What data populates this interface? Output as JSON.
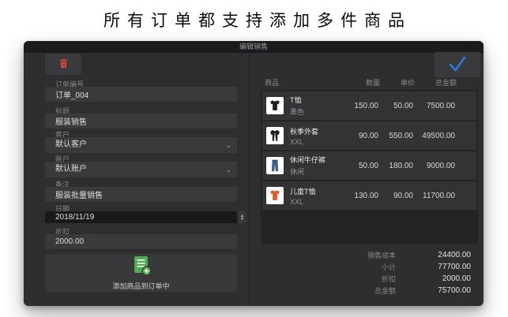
{
  "page": {
    "headline": "所有订单都支持添加多件商品"
  },
  "window": {
    "title": "编辑销售",
    "toolbar": {
      "delete_icon": "trash-icon",
      "confirm_icon": "check-icon"
    },
    "form": {
      "fields": [
        {
          "type": "text",
          "label": "订单编号",
          "value": "订单_004"
        },
        {
          "type": "text",
          "label": "标题",
          "value": "服装销售"
        },
        {
          "type": "select",
          "label": "客户",
          "value": "默认客户"
        },
        {
          "type": "select",
          "label": "账户",
          "value": "默认账户"
        },
        {
          "type": "text",
          "label": "备注",
          "value": "服装批量销售"
        },
        {
          "type": "date",
          "label": "日期",
          "value": "2018/11/19"
        },
        {
          "type": "text",
          "label": "折扣",
          "value": "2000.00"
        }
      ],
      "add_button_label": "添加商品到订单中",
      "add_button_icon": "invoice-add-icon"
    },
    "table": {
      "headers": [
        "商品",
        "数量",
        "单价",
        "总金额"
      ],
      "rows": [
        {
          "icon": "tshirt-black-icon",
          "name": "T恤",
          "variant": "黑色",
          "qty": "150.00",
          "price": "50.00",
          "total": "7500.00"
        },
        {
          "icon": "jacket-icon",
          "name": "秋季外套",
          "variant": "XXL",
          "qty": "90.00",
          "price": "550.00",
          "total": "49500.00"
        },
        {
          "icon": "jeans-icon",
          "name": "休闲牛仔裤",
          "variant": "休闲",
          "qty": "50.00",
          "price": "180.00",
          "total": "9000.00"
        },
        {
          "icon": "tshirt-orange-icon",
          "name": "儿童T恤",
          "variant": "XXL",
          "qty": "130.00",
          "price": "90.00",
          "total": "11700.00"
        }
      ]
    },
    "summary": [
      {
        "label": "销售成本",
        "value": "24400.00"
      },
      {
        "label": "小计",
        "value": "77700.00"
      },
      {
        "label": "折扣",
        "value": "2000.00"
      },
      {
        "label": "总金额",
        "value": "75700.00"
      }
    ]
  },
  "colors": {
    "accent_red": "#e14b3b",
    "accent_blue": "#2e7bdb",
    "accent_green": "#4caf50",
    "window_bg": "#2e2e30",
    "field_bg": "#3a3a3c",
    "table_bg": "#242426",
    "row_bg": "#333335"
  }
}
